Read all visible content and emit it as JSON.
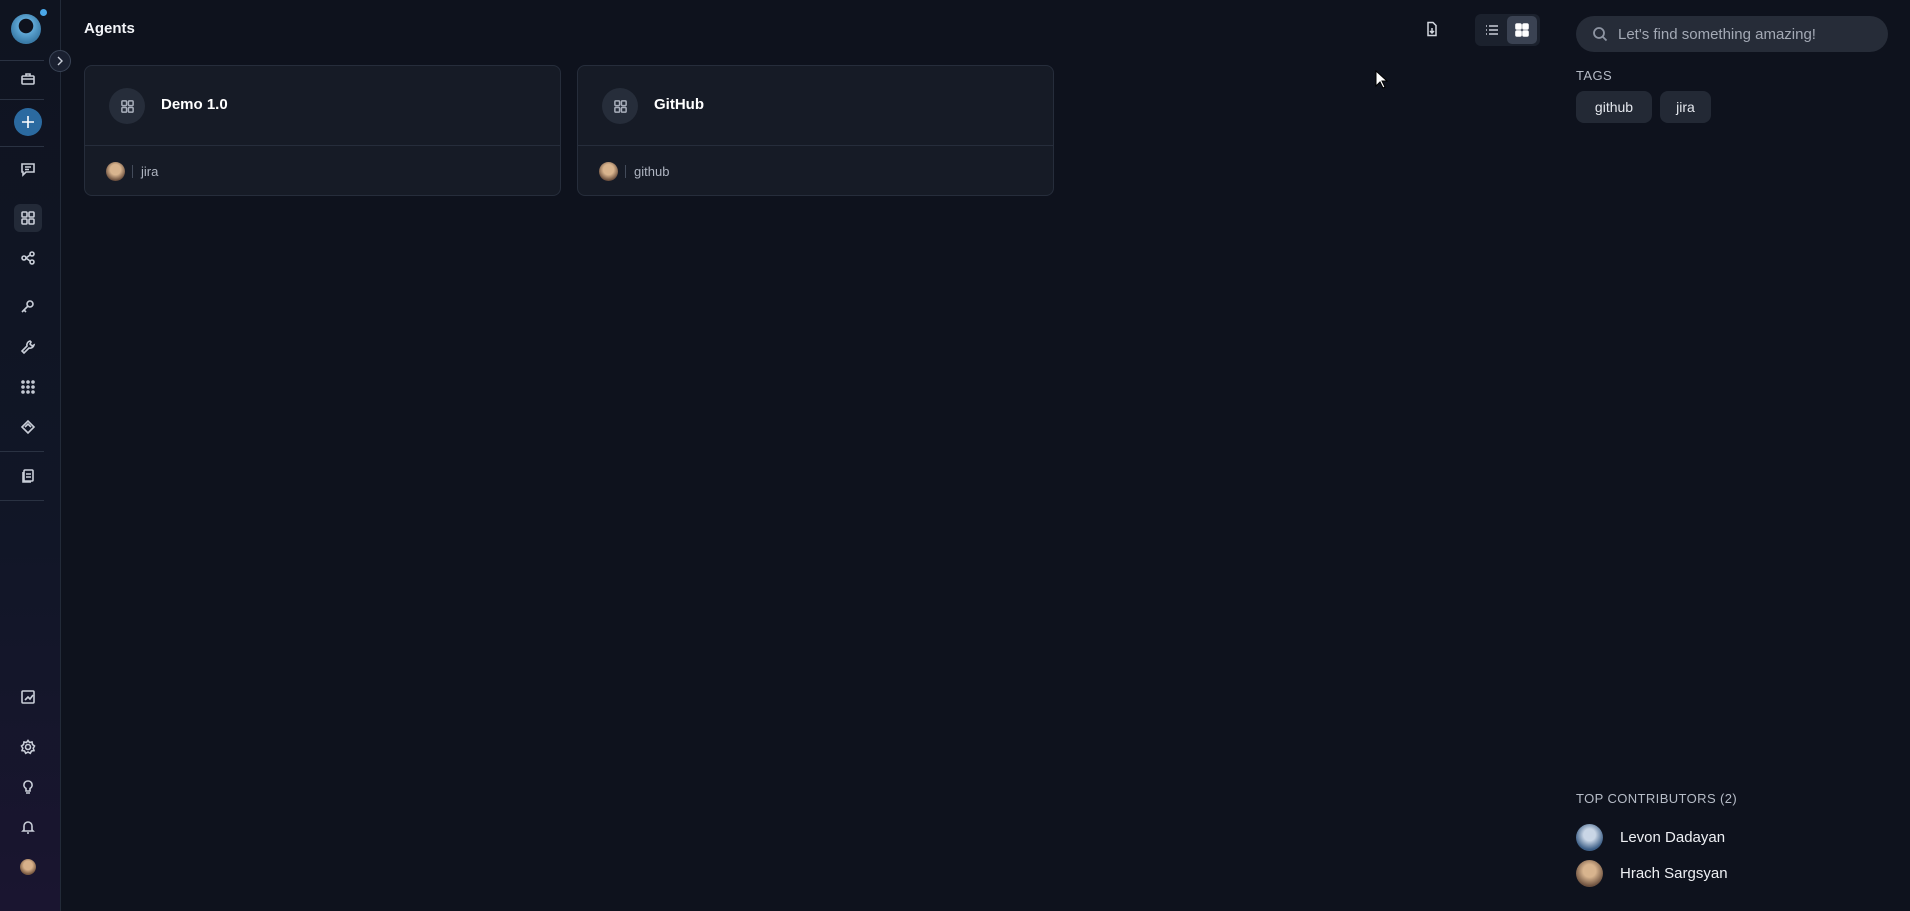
{
  "header": {
    "title": "Agents"
  },
  "cards": [
    {
      "title": "Demo 1.0",
      "tag": "jira"
    },
    {
      "title": "GitHub",
      "tag": "github"
    }
  ],
  "search": {
    "placeholder": "Let's find something amazing!"
  },
  "tags": {
    "label": "TAGS",
    "items": [
      "github",
      "jira"
    ]
  },
  "contributors": {
    "label": "TOP CONTRIBUTORS (2)",
    "items": [
      "Levon Dadayan",
      "Hrach Sargsyan"
    ]
  },
  "icons": {
    "sidebar": [
      "briefcase-icon",
      "plus-icon",
      "chat-icon",
      "grid-icon",
      "flow-icon",
      "key-icon",
      "wrench-icon",
      "apps-icon",
      "prompts-icon",
      "docs-icon",
      "report-icon",
      "settings-icon",
      "lightbulb-icon",
      "bell-icon"
    ],
    "toolbar": [
      "export-icon",
      "list-view-icon",
      "grid-view-icon"
    ]
  },
  "colors": {
    "background": "#0e121d",
    "card": "#161b26",
    "accent": "#2b6aa0"
  }
}
